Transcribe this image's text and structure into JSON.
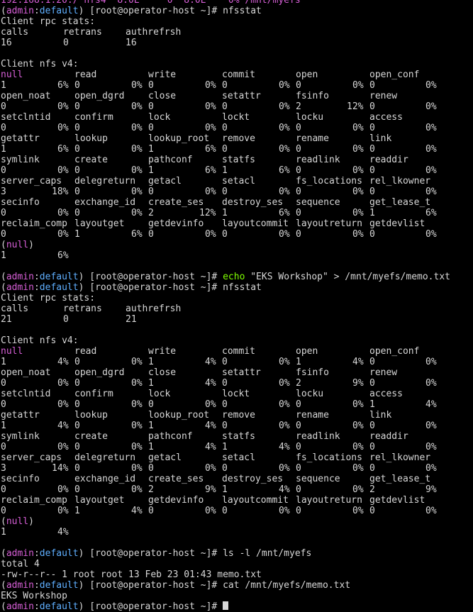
{
  "colors": {
    "background": "#000000",
    "text": "#d7d7d7",
    "admin": "#d75fd7",
    "default": "#5fafff",
    "echo_cmd": "#7fff00"
  },
  "prompt": {
    "open": "(",
    "admin": "admin",
    ":": ":",
    "colon": ":",
    "default": "default",
    "close": ")",
    "rest": " [root@operator-host ~]# "
  },
  "top_partial": "192.168.1.20:/ nfs4  8.0E     0  8.0E    0% /mnt/myefs",
  "commands": {
    "nfsstat": "nfsstat",
    "echo_kw": "echo",
    "echo_args": " \"EKS Workshop\" > /mnt/myefs/memo.txt",
    "ls": "ls -l /mnt/myefs",
    "cat": "cat /mnt/myefs/memo.txt"
  },
  "labels": {
    "client_rpc": "Client rpc stats:",
    "client_nfs": "Client nfs v4:",
    "rpc_headers": [
      "calls",
      "retrans",
      "authrefrsh"
    ]
  },
  "nfs_headers": [
    [
      "null",
      "read",
      "write",
      "commit",
      "open",
      "open_conf"
    ],
    [
      "open_noat",
      "open_dgrd",
      "close",
      "setattr",
      "fsinfo",
      "renew"
    ],
    [
      "setclntid",
      "confirm",
      "lock",
      "lockt",
      "locku",
      "access"
    ],
    [
      "getattr",
      "lookup",
      "lookup_root",
      "remove",
      "rename",
      "link"
    ],
    [
      "symlink",
      "create",
      "pathconf",
      "statfs",
      "readlink",
      "readdir"
    ],
    [
      "server_caps",
      "delegreturn",
      "getacl",
      "setacl",
      "fs_locations",
      "rel_lkowner"
    ],
    [
      "secinfo",
      "exchange_id",
      "create_ses",
      "destroy_ses",
      "sequence",
      "get_lease_t"
    ],
    [
      "reclaim_comp",
      "layoutget",
      "getdevinfo",
      "layoutcommit",
      "layoutreturn",
      "getdevlist"
    ]
  ],
  "stats1": {
    "rpc_values": [
      "16",
      "0",
      "16"
    ],
    "rows": [
      [
        [
          "1",
          "6%"
        ],
        [
          "0",
          "0%"
        ],
        [
          "0",
          "0%"
        ],
        [
          "0",
          "0%"
        ],
        [
          "0",
          "0%"
        ],
        [
          "0",
          "0%"
        ]
      ],
      [
        [
          "0",
          "0%"
        ],
        [
          "0",
          "0%"
        ],
        [
          "0",
          "0%"
        ],
        [
          "0",
          "0%"
        ],
        [
          "2",
          "12%"
        ],
        [
          "0",
          "0%"
        ]
      ],
      [
        [
          "0",
          "0%"
        ],
        [
          "0",
          "0%"
        ],
        [
          "0",
          "0%"
        ],
        [
          "0",
          "0%"
        ],
        [
          "0",
          "0%"
        ],
        [
          "0",
          "0%"
        ]
      ],
      [
        [
          "1",
          "6%"
        ],
        [
          "0",
          "0%"
        ],
        [
          "1",
          "6%"
        ],
        [
          "0",
          "0%"
        ],
        [
          "0",
          "0%"
        ],
        [
          "0",
          "0%"
        ]
      ],
      [
        [
          "0",
          "0%"
        ],
        [
          "0",
          "0%"
        ],
        [
          "1",
          "6%"
        ],
        [
          "1",
          "6%"
        ],
        [
          "0",
          "0%"
        ],
        [
          "0",
          "0%"
        ]
      ],
      [
        [
          "3",
          "18%"
        ],
        [
          "0",
          "0%"
        ],
        [
          "0",
          "0%"
        ],
        [
          "0",
          "0%"
        ],
        [
          "0",
          "0%"
        ],
        [
          "0",
          "0%"
        ]
      ],
      [
        [
          "0",
          "0%"
        ],
        [
          "0",
          "0%"
        ],
        [
          "2",
          "12%"
        ],
        [
          "1",
          "6%"
        ],
        [
          "0",
          "0%"
        ],
        [
          "1",
          "6%"
        ]
      ],
      [
        [
          "0",
          "0%"
        ],
        [
          "1",
          "6%"
        ],
        [
          "0",
          "0%"
        ],
        [
          "0",
          "0%"
        ],
        [
          "0",
          "0%"
        ],
        [
          "0",
          "0%"
        ]
      ]
    ],
    "null_label": "(null)",
    "null_values": [
      "1",
      "6%"
    ]
  },
  "stats2": {
    "rpc_values": [
      "21",
      "0",
      "21"
    ],
    "rows": [
      [
        [
          "1",
          "4%"
        ],
        [
          "0",
          "0%"
        ],
        [
          "1",
          "4%"
        ],
        [
          "0",
          "0%"
        ],
        [
          "1",
          "4%"
        ],
        [
          "0",
          "0%"
        ]
      ],
      [
        [
          "0",
          "0%"
        ],
        [
          "0",
          "0%"
        ],
        [
          "1",
          "4%"
        ],
        [
          "0",
          "0%"
        ],
        [
          "2",
          "9%"
        ],
        [
          "0",
          "0%"
        ]
      ],
      [
        [
          "0",
          "0%"
        ],
        [
          "0",
          "0%"
        ],
        [
          "0",
          "0%"
        ],
        [
          "0",
          "0%"
        ],
        [
          "0",
          "0%"
        ],
        [
          "1",
          "4%"
        ]
      ],
      [
        [
          "1",
          "4%"
        ],
        [
          "0",
          "0%"
        ],
        [
          "1",
          "4%"
        ],
        [
          "0",
          "0%"
        ],
        [
          "0",
          "0%"
        ],
        [
          "0",
          "0%"
        ]
      ],
      [
        [
          "0",
          "0%"
        ],
        [
          "0",
          "0%"
        ],
        [
          "1",
          "4%"
        ],
        [
          "1",
          "4%"
        ],
        [
          "0",
          "0%"
        ],
        [
          "0",
          "0%"
        ]
      ],
      [
        [
          "3",
          "14%"
        ],
        [
          "0",
          "0%"
        ],
        [
          "0",
          "0%"
        ],
        [
          "0",
          "0%"
        ],
        [
          "0",
          "0%"
        ],
        [
          "0",
          "0%"
        ]
      ],
      [
        [
          "0",
          "0%"
        ],
        [
          "0",
          "0%"
        ],
        [
          "2",
          "9%"
        ],
        [
          "1",
          "4%"
        ],
        [
          "0",
          "0%"
        ],
        [
          "2",
          "9%"
        ]
      ],
      [
        [
          "0",
          "0%"
        ],
        [
          "1",
          "4%"
        ],
        [
          "0",
          "0%"
        ],
        [
          "0",
          "0%"
        ],
        [
          "0",
          "0%"
        ],
        [
          "0",
          "0%"
        ]
      ]
    ],
    "null_label": "(null)",
    "null_values": [
      "1",
      "4%"
    ]
  },
  "ls_output": [
    "total 4",
    "-rw-r--r-- 1 root root 13 Feb 23 01:43 memo.txt"
  ],
  "cat_output": "EKS Workshop"
}
